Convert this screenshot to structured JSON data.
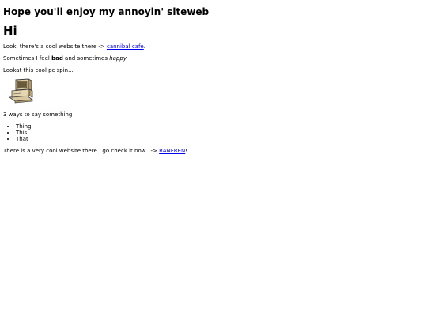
{
  "site_title": "Hope you'll enjoy my annoyin' siteweb",
  "heading": "Hi",
  "line1": {
    "prefix": "Look, there's a cool website there -> ",
    "link_text": "cannibal cafe",
    "suffix": "."
  },
  "line2": {
    "prefix": "Sometimes I feel ",
    "bold": "bad",
    "middle": " and sometimes ",
    "italic": "happy"
  },
  "line3": "Lookat this cool pc spin...",
  "pc_image": {
    "icon": "spinning-computer-icon"
  },
  "line4": "3 ways to say something",
  "ways": [
    "Thing",
    "This",
    "That"
  ],
  "line5": {
    "prefix": "There is a very cool website there...go check it now...-> ",
    "link_text": "RANFREN",
    "suffix": "!"
  },
  "colors": {
    "link": "#0000ee",
    "text": "#000000",
    "background": "#ffffff"
  }
}
